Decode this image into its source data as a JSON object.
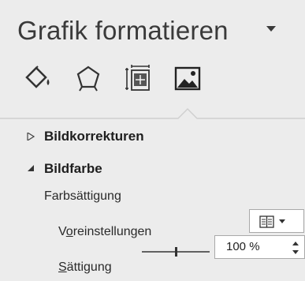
{
  "pane": {
    "title": "Grafik formatieren",
    "tabs": [
      {
        "icon": "fill-line-icon"
      },
      {
        "icon": "effects-icon"
      },
      {
        "icon": "size-properties-icon"
      },
      {
        "icon": "picture-icon",
        "selected": true
      }
    ]
  },
  "sections": {
    "bildkorrekturen": {
      "label": "Bildkorrekturen",
      "expanded": false
    },
    "bildfarbe": {
      "label": "Bildfarbe",
      "expanded": true,
      "farbsaettigung": {
        "label": "Farbsättigung",
        "voreinstellungen": {
          "label_mnemonic": "o",
          "label_rest": "reinstellungen",
          "label_prefix": "V"
        },
        "saettigung": {
          "label_mnemonic": "S",
          "label_rest": "ättigung",
          "value": "100 %",
          "level_fraction": 0.5
        }
      }
    }
  },
  "colors": {
    "background": "#ececec",
    "text": "#222222",
    "input_border": "#a9a9a9"
  }
}
